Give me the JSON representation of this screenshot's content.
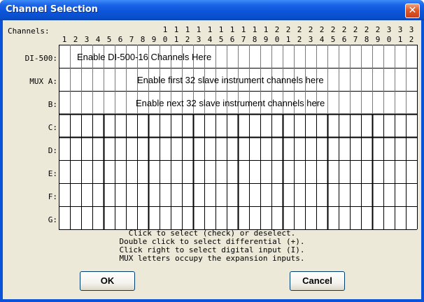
{
  "window": {
    "title": "Channel Selection",
    "close_glyph": "✕"
  },
  "grid": {
    "channels_label": "Channels:",
    "columns": [
      "1",
      "2",
      "3",
      "4",
      "5",
      "6",
      "7",
      "8",
      "9",
      "10",
      "11",
      "12",
      "13",
      "14",
      "15",
      "16",
      "17",
      "18",
      "19",
      "20",
      "21",
      "22",
      "23",
      "24",
      "25",
      "26",
      "27",
      "28",
      "29",
      "30",
      "31",
      "32"
    ],
    "rows": [
      {
        "label": "DI-500:",
        "text": "Enable DI-500-16 Channels Here"
      },
      {
        "label": "MUX A:",
        "text": "Enable first 32 slave instrument channels here"
      },
      {
        "label": "B:",
        "text": "Enable next 32 slave instrument channels here"
      },
      {
        "label": "C:",
        "text": ""
      },
      {
        "label": "D:",
        "text": ""
      },
      {
        "label": "E:",
        "text": ""
      },
      {
        "label": "F:",
        "text": ""
      },
      {
        "label": "G:",
        "text": ""
      }
    ]
  },
  "help_lines": [
    "Click to select (check) or deselect.",
    "Double click to select differential (+).",
    "Click right to select digital input (I).",
    "MUX letters occupy the expansion inputs."
  ],
  "buttons": {
    "ok": "OK",
    "cancel": "Cancel"
  },
  "colors": {
    "titlebar": "#0a52d8",
    "dialog_bg": "#ece9d8",
    "grid_bg": "#ffffff",
    "close_button": "#e05a2a"
  }
}
